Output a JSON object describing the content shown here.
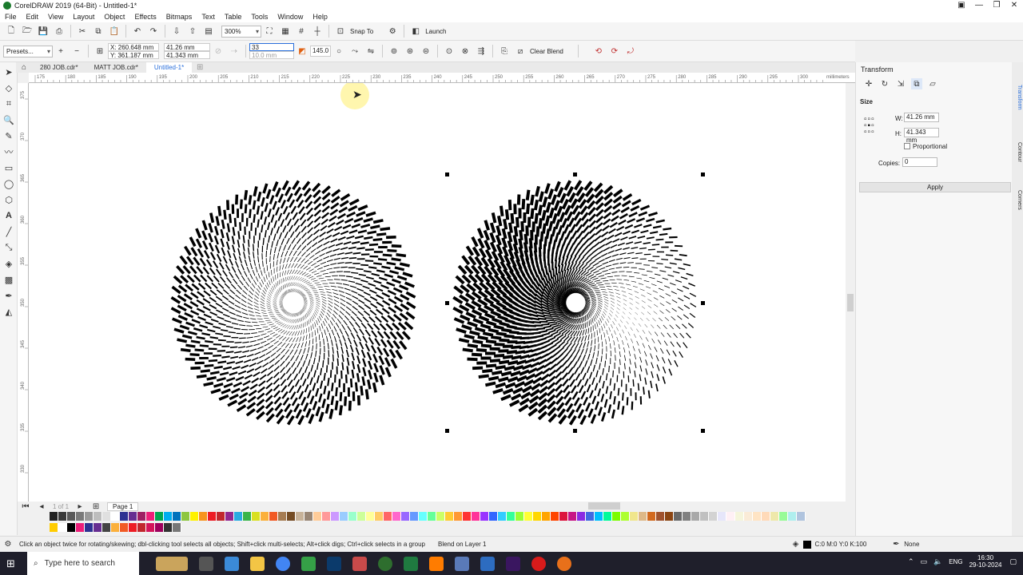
{
  "window": {
    "title": "CorelDRAW 2019 (64-Bit) - Untitled-1*"
  },
  "menu": [
    "File",
    "Edit",
    "View",
    "Layout",
    "Object",
    "Effects",
    "Bitmaps",
    "Text",
    "Table",
    "Tools",
    "Window",
    "Help"
  ],
  "toolbar1": {
    "zoom": "300%",
    "snap_to": "Snap To",
    "launch": "Launch"
  },
  "toolbar2": {
    "presets": "Presets...",
    "x": "X: 260.648 mm",
    "y": "Y: 361.187 mm",
    "w": "41.26 mm",
    "h": "41.343 mm",
    "steps": "33",
    "spacing": "10.0 mm",
    "angle": "145.0",
    "clear_blend": "Clear Blend"
  },
  "tabs": [
    {
      "label": "280 JOB.cdr*"
    },
    {
      "label": "MATT JOB.cdr*"
    },
    {
      "label": "Untitled-1*"
    }
  ],
  "ruler_h": {
    "labels": [
      "175",
      "180",
      "185",
      "190",
      "195",
      "200",
      "205",
      "210",
      "215",
      "220",
      "225",
      "230",
      "235",
      "240",
      "245",
      "250",
      "255",
      "260",
      "265",
      "270",
      "275",
      "280",
      "285",
      "290",
      "295",
      "300"
    ],
    "unit": "millimeters"
  },
  "ruler_v": {
    "labels": [
      "375",
      "370",
      "365",
      "360",
      "355",
      "350",
      "345",
      "340",
      "335",
      "330"
    ]
  },
  "page_bar": {
    "counter": "1 of 1",
    "page": "Page 1"
  },
  "docker": {
    "title": "Transform",
    "section": "Size",
    "w_label": "W:",
    "w_value": "41.26 mm",
    "h_label": "H:",
    "h_value": "41.343 mm",
    "proportional": "Proportional",
    "copies_label": "Copies:",
    "copies_value": "0",
    "apply": "Apply"
  },
  "side_tabs": [
    "Transform",
    "Contour",
    "Corners"
  ],
  "status": {
    "hint": "Click an object twice for rotating/skewing; dbl-clicking tool selects all objects; Shift+click multi-selects; Alt+click digs; Ctrl+click selects in a group",
    "layer": "Blend on Layer 1",
    "fill": "C:0 M:0 Y:0 K:100",
    "outline": "None"
  },
  "taskbar": {
    "search": "Type here to search",
    "lang": "ENG",
    "time": "16:30",
    "date": "29-10-2024"
  },
  "colors": {
    "accent": "#2a6fdb",
    "palette": [
      "#222222",
      "#3a3a3a",
      "#5a5a5a",
      "#7a7a7a",
      "#9a9a9a",
      "#bdbdbd",
      "#e0e0e0",
      "#ffffff",
      "#2e3192",
      "#662d91",
      "#9e1f63",
      "#ed1e79",
      "#00a651",
      "#00aeef",
      "#0072bc",
      "#8dc63f",
      "#fff200",
      "#f7941d",
      "#ed1c24",
      "#c1272d",
      "#92278f",
      "#29abe2",
      "#39b54a",
      "#d9e021",
      "#fbb03b",
      "#f15a24",
      "#a67c52",
      "#754c24",
      "#c7b299",
      "#998675",
      "#ffcc99",
      "#ff9999",
      "#cc99ff",
      "#99ccff",
      "#99ffcc",
      "#ccff99",
      "#ffff99",
      "#ffcc66",
      "#ff6666",
      "#ff66cc",
      "#9966ff",
      "#6699ff",
      "#66ffff",
      "#66ff99",
      "#ccff66",
      "#ffcc33",
      "#ff9933",
      "#ff3333",
      "#ff3399",
      "#9933ff",
      "#3366ff",
      "#33ccff",
      "#33ff99",
      "#99ff33",
      "#ffff33",
      "#ffd700",
      "#ffa500",
      "#ff4500",
      "#dc143c",
      "#c71585",
      "#8a2be2",
      "#4169e1",
      "#00bfff",
      "#00fa9a",
      "#7cfc00",
      "#adff2f",
      "#f0e68c",
      "#deb887",
      "#d2691e",
      "#a0522d",
      "#8b4513",
      "#696969",
      "#808080",
      "#a9a9a9",
      "#c0c0c0",
      "#d3d3d3",
      "#e6e6fa",
      "#fff0f5",
      "#f5f5dc",
      "#faebd7",
      "#ffe4c4",
      "#ffdab9",
      "#eee8aa",
      "#98fb98",
      "#afeeee",
      "#b0c4de"
    ],
    "palette2": [
      "#ffcc00",
      "#ffffff",
      "#000000",
      "#ed1e79",
      "#2e3192",
      "#662d91",
      "#444444",
      "#fbb03b",
      "#f15a24",
      "#ed1c24",
      "#c1272d",
      "#d4145a",
      "#9e005d",
      "#333333",
      "#777777"
    ]
  }
}
